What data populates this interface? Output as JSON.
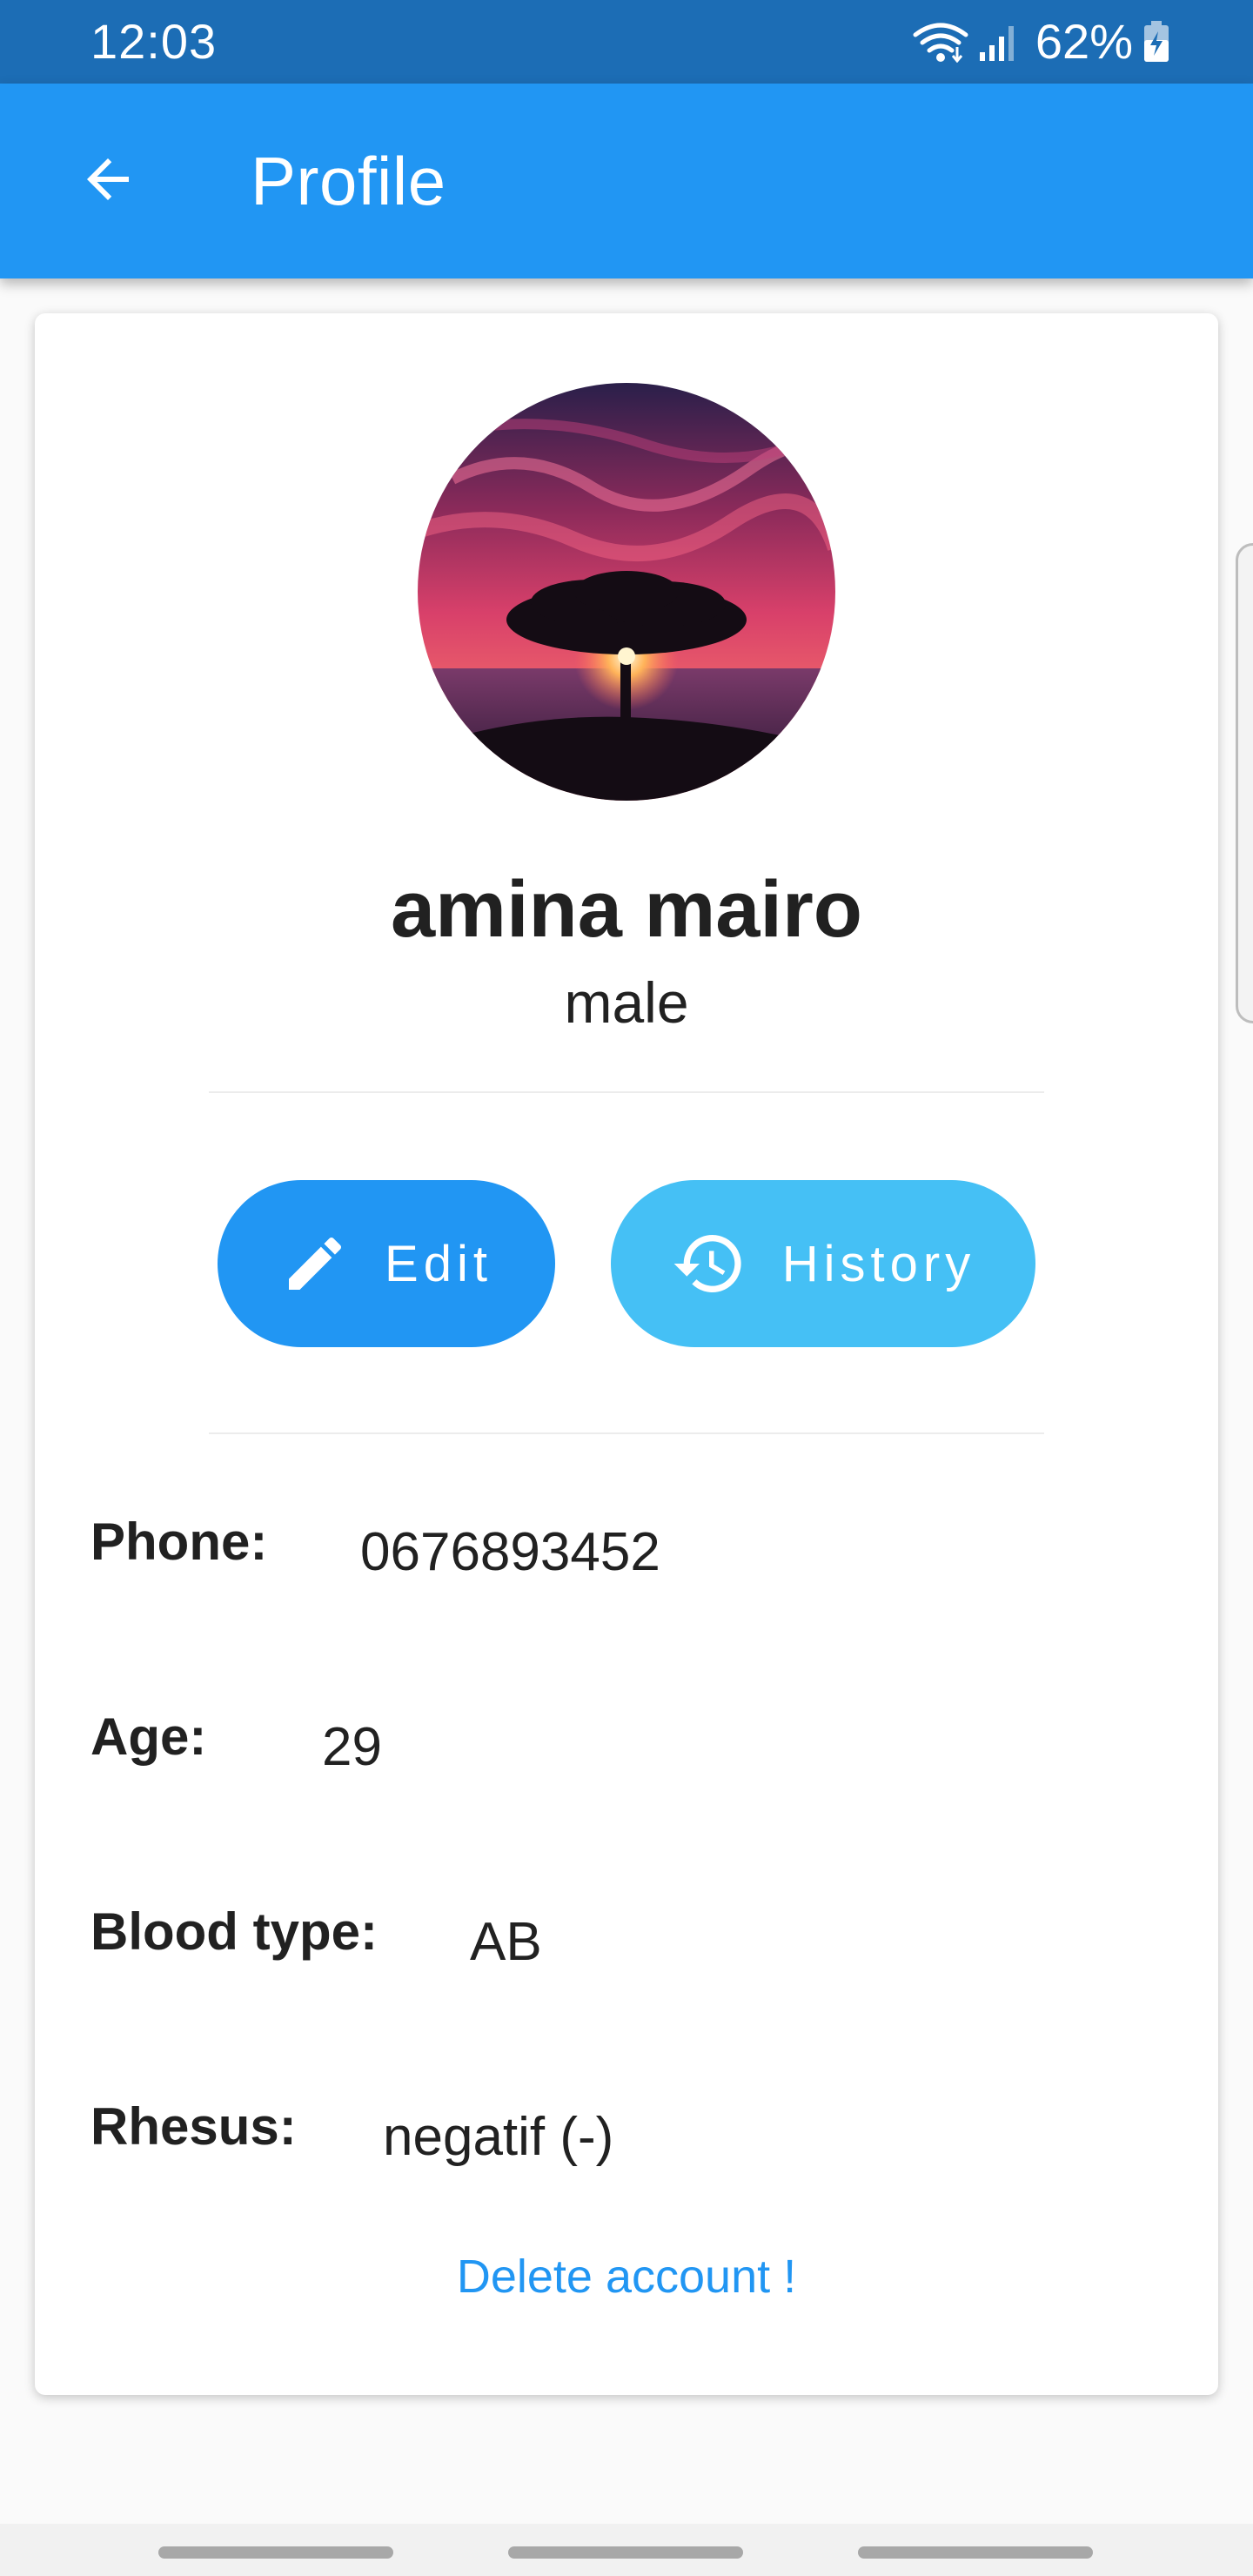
{
  "status_bar": {
    "time": "12:03",
    "battery_percent": "62%",
    "icons": [
      "wifi-icon",
      "signal-icon",
      "battery-charging-icon"
    ]
  },
  "app_bar": {
    "title": "Profile",
    "back_icon": "arrow-back-icon",
    "background_color": "#2196f3"
  },
  "profile": {
    "avatar_description": "avatar",
    "name": "amina mairo",
    "gender": "male"
  },
  "actions": {
    "edit_label": "Edit",
    "edit_icon": "pencil-icon",
    "edit_color": "#2196f3",
    "history_label": "History",
    "history_icon": "history-icon",
    "history_color": "#45c0f5"
  },
  "details": {
    "phone": {
      "label": "Phone:",
      "value": "0676893452"
    },
    "age": {
      "label": "Age:",
      "value": "29"
    },
    "blood_type": {
      "label": "Blood type:",
      "value": "AB"
    },
    "rhesus": {
      "label": "Rhesus:",
      "value": "negatif (-)"
    }
  },
  "delete_account": {
    "label": "Delete account !",
    "color": "#2196f3"
  }
}
